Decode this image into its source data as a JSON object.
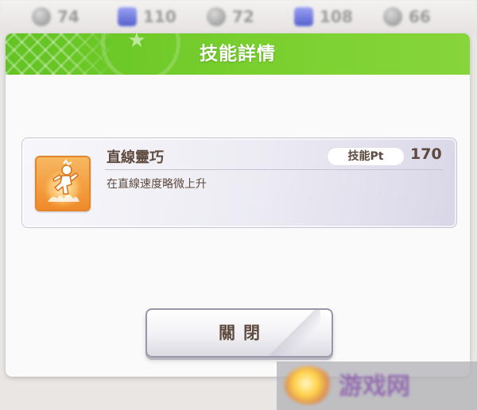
{
  "stats": [
    {
      "icon": "silver-medal-icon",
      "value": "74"
    },
    {
      "icon": "purple-card-icon",
      "value": "110"
    },
    {
      "icon": "silver-medal-icon",
      "value": "72"
    },
    {
      "icon": "purple-card-icon",
      "value": "108"
    },
    {
      "icon": "silver-medal-icon",
      "value": "66"
    }
  ],
  "dialog": {
    "title": "技能詳情"
  },
  "skill": {
    "name": "直線靈巧",
    "description": "在直線速度略微上升",
    "pt_label": "技能Pt",
    "pt_value": "170",
    "icon": "running-figure-icon"
  },
  "buttons": {
    "close_label": "關閉"
  },
  "colors": {
    "header_green": "#6cc928",
    "text_brown": "#5e4a3e",
    "icon_orange": "#f08a2a"
  }
}
